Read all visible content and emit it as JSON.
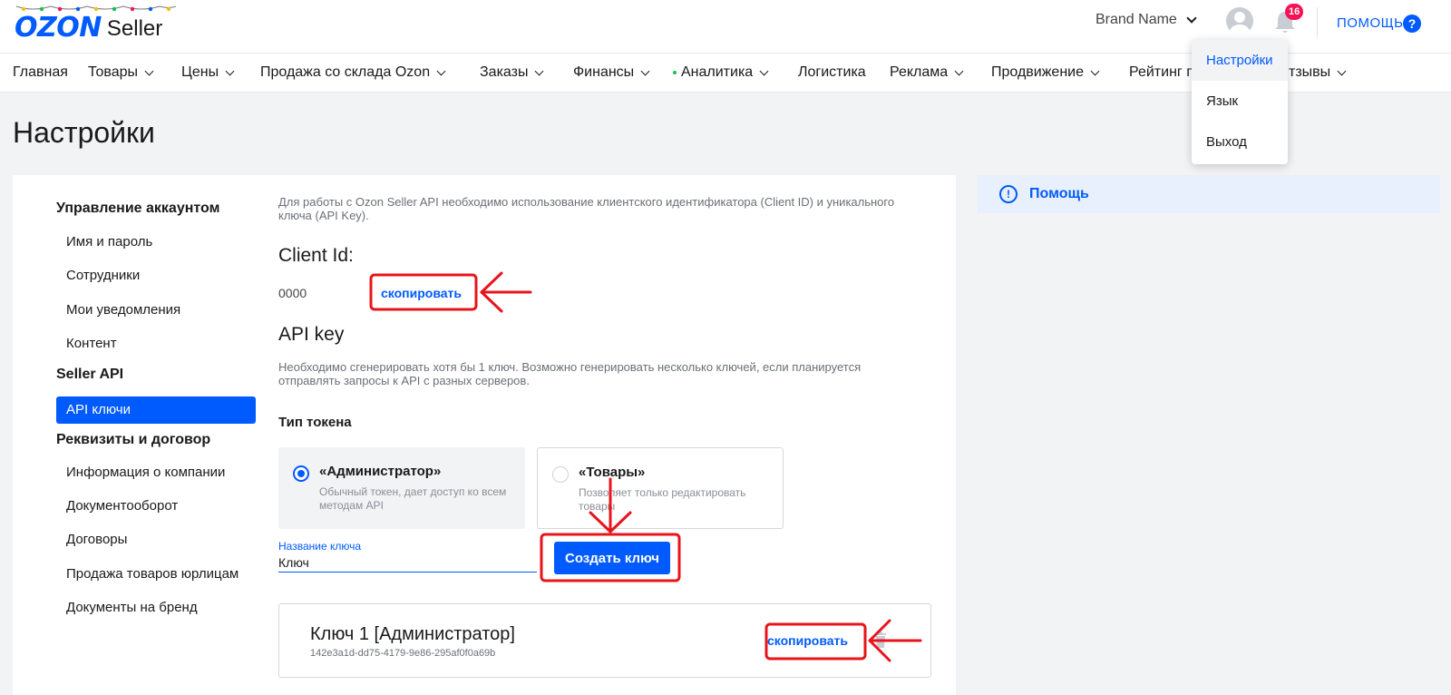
{
  "header": {
    "logo_brand": "OZON",
    "logo_product": "Seller",
    "brand_name": "Brand Name",
    "notifications_count": "16",
    "help_label": "ПОМОЩЬ",
    "help_icon": "question-icon"
  },
  "nav": {
    "items": [
      {
        "label": "Главная",
        "has_dropdown": false
      },
      {
        "label": "Товары",
        "has_dropdown": true
      },
      {
        "label": "Цены",
        "has_dropdown": true
      },
      {
        "label": "Продажа со склада Ozon",
        "has_dropdown": true
      },
      {
        "label": "Заказы",
        "has_dropdown": true
      },
      {
        "label": "Финансы",
        "has_dropdown": true
      },
      {
        "label": "Аналитика",
        "has_dropdown": true
      },
      {
        "label": "Логистика",
        "has_dropdown": false
      },
      {
        "label": "Реклама",
        "has_dropdown": true
      },
      {
        "label": "Продвижение",
        "has_dropdown": true
      },
      {
        "label": "Рейтинг п",
        "has_dropdown": false
      },
      {
        "label": "тзывы",
        "has_dropdown": true
      }
    ]
  },
  "user_menu": {
    "items": [
      {
        "label": "Настройки",
        "active": true
      },
      {
        "label": "Язык",
        "active": false
      },
      {
        "label": "Выход",
        "active": false
      }
    ]
  },
  "page": {
    "title": "Настройки"
  },
  "sidebar": {
    "sections": [
      {
        "heading": "Управление аккаунтом",
        "items": [
          "Имя и пароль",
          "Сотрудники",
          "Мои уведомления",
          "Контент"
        ]
      },
      {
        "heading": "Seller API",
        "items": [
          "API ключи"
        ]
      },
      {
        "heading": "Реквизиты и договор",
        "items": [
          "Информация о компании",
          "Документооборот",
          "Договоры",
          "Продажа товаров юрлицам",
          "Документы на бренд"
        ]
      }
    ],
    "active_item": "API ключи"
  },
  "content": {
    "intro": "Для работы с Ozon Seller API необходимо использование клиентского идентификатора (Client ID) и уникального ключа (API Key).",
    "client_id_heading": "Client Id:",
    "client_id_value": "0000",
    "copy_label": "скопировать",
    "api_key_heading": "API key",
    "api_key_desc": "Необходимо сгенерировать хотя бы 1 ключ. Возможно генерировать несколько ключей, если планируется отправлять запросы к API с разных серверов.",
    "token_type_label": "Тип токена",
    "token_types": [
      {
        "title": "«Администратор»",
        "desc": "Обычный токен, дает доступ ко всем методам API",
        "selected": true
      },
      {
        "title": "«Товары»",
        "desc": "Позволяет только редактировать товары",
        "selected": false
      }
    ],
    "key_name_label": "Название ключа",
    "key_name_value": "Ключ",
    "create_button": "Создать ключ",
    "keys": [
      {
        "title": "Ключ 1 [Администратор]",
        "id": "142e3a1d-dd75-4179-9e86-295af0f0a69b",
        "copy_label": "скопировать"
      }
    ]
  },
  "help_panel": {
    "label": "Помощь",
    "icon": "info-icon"
  },
  "colors": {
    "accent": "#005bff",
    "annotation": "#e8141b",
    "badge": "#f91155",
    "background": "#f2f3f5"
  }
}
